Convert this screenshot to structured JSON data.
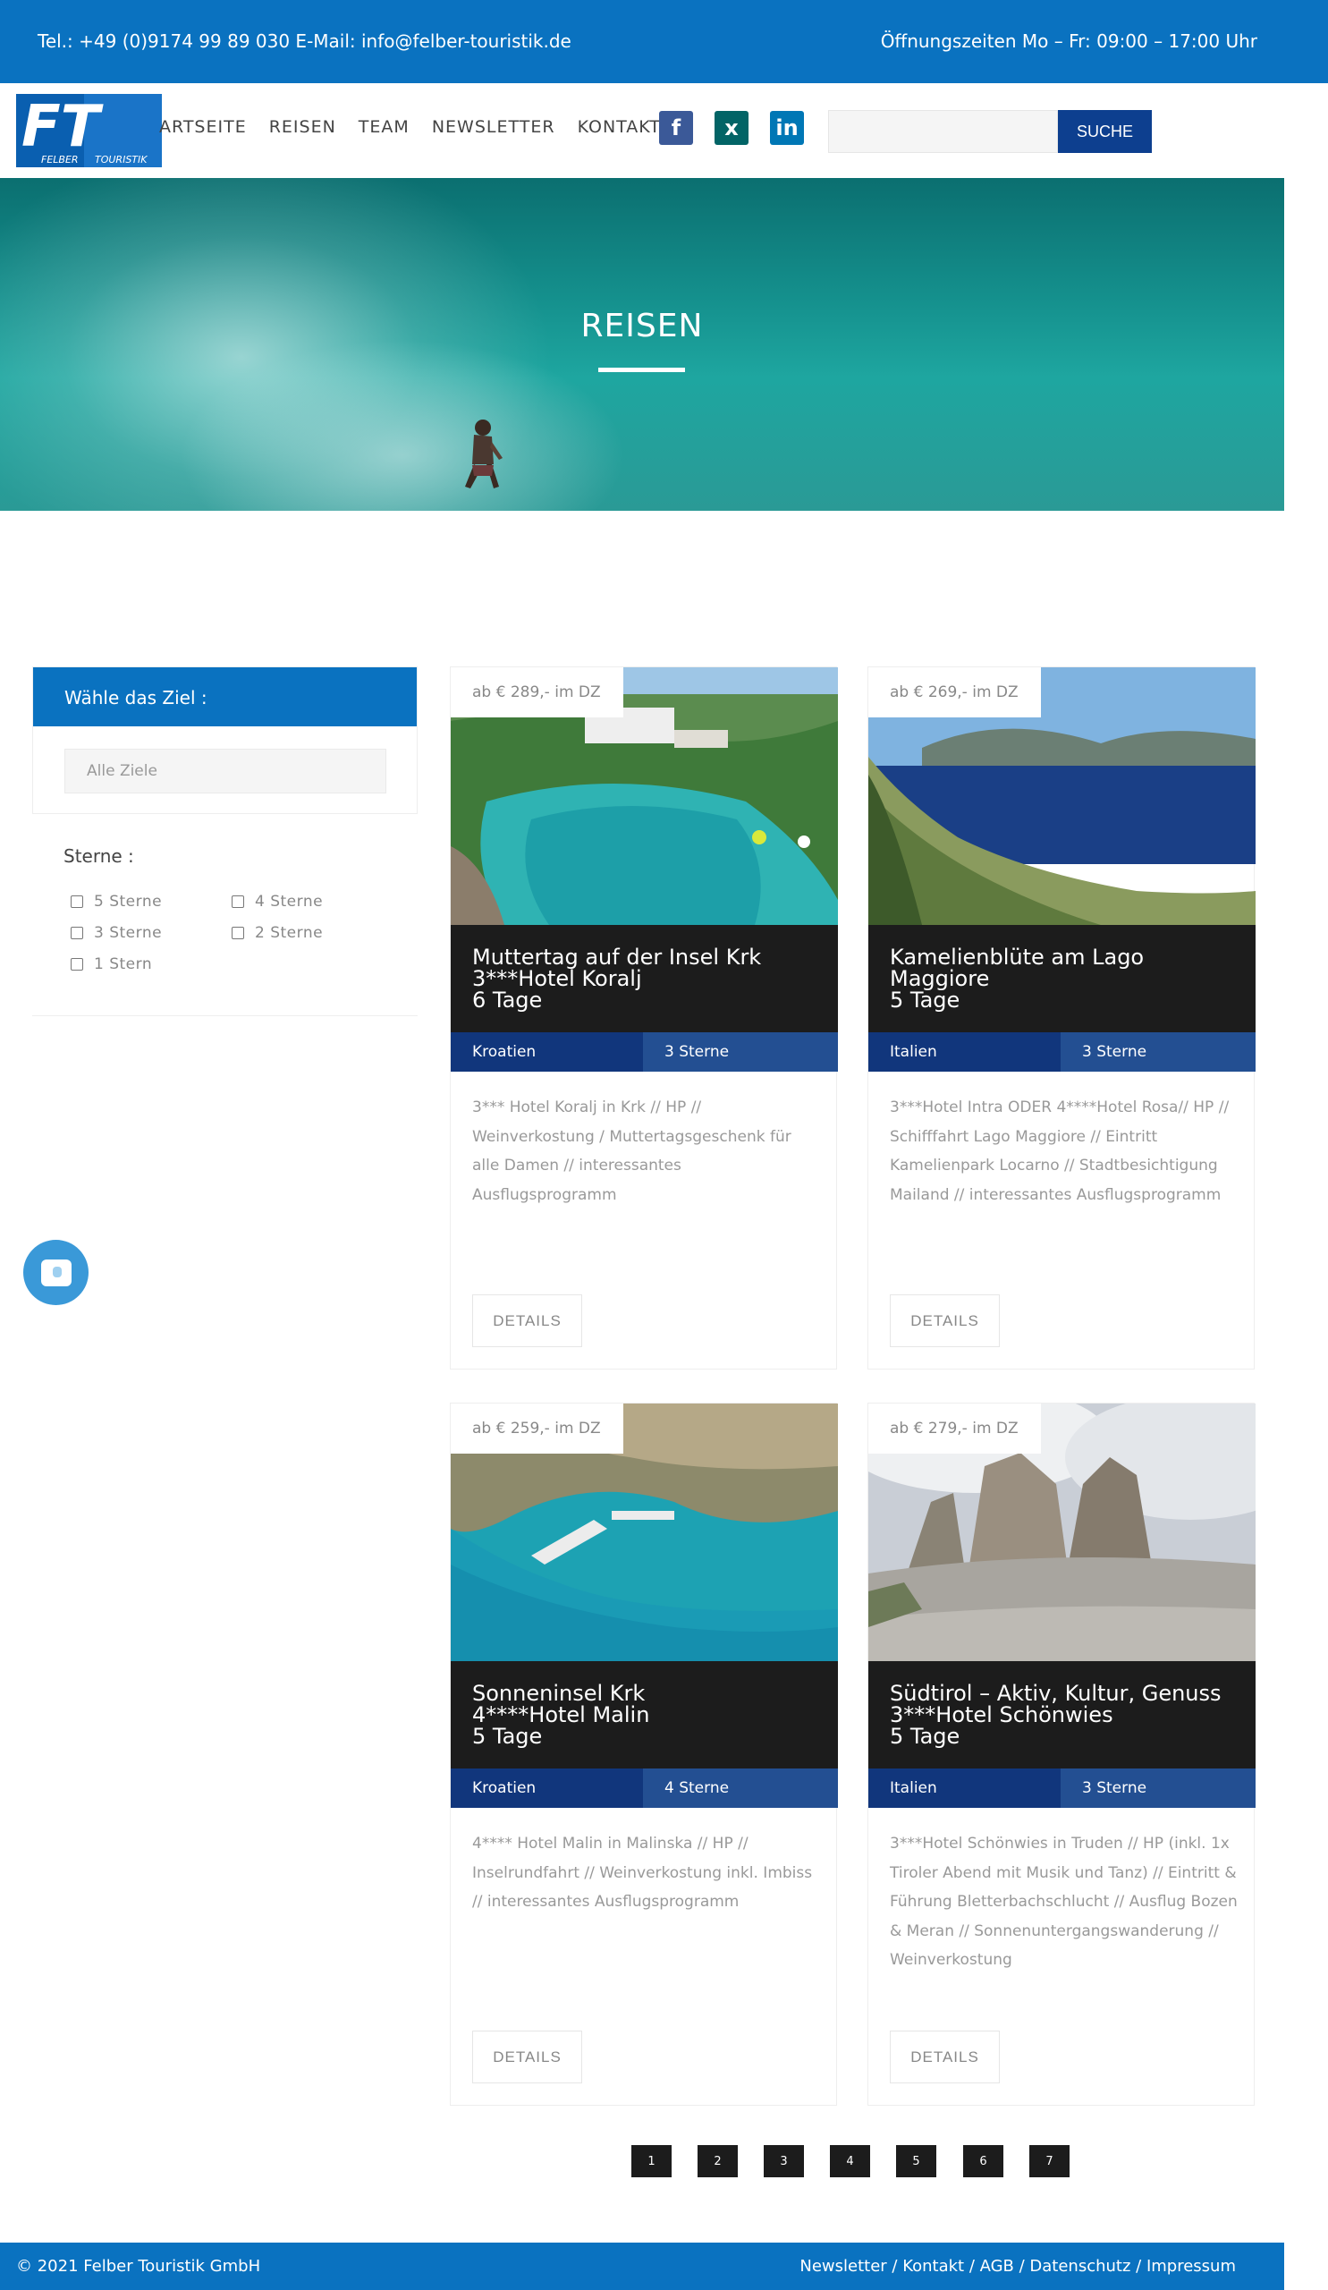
{
  "topbar": {
    "contact": "Tel.: +49 (0)9174 99 89 030 E-Mail: info@felber-touristik.de",
    "hours": "Öffnungszeiten Mo – Fr: 09:00 – 17:00 Uhr"
  },
  "header": {
    "logo_text_main": "FT",
    "logo_text_sub1": "FELBER",
    "logo_text_sub2": "TOURISTIK",
    "nav": [
      "ARTSEITE",
      "REISEN",
      "TEAM",
      "NEWSLETTER",
      "KONTAKT"
    ],
    "social": {
      "fb": "f",
      "xing": "x",
      "li": "in"
    },
    "search_value": "",
    "search_button": "SUCHE"
  },
  "hero": {
    "title": "REISEN"
  },
  "sidebar": {
    "filter_title": "Wähle das Ziel :",
    "filter_value": "Alle Ziele",
    "stars_label": "Sterne :",
    "star_options": [
      "5 Sterne",
      "4 Sterne",
      "3 Sterne",
      "2 Sterne",
      "1 Stern"
    ]
  },
  "cards": [
    {
      "price": "ab € 289,- im DZ",
      "title": [
        "Muttertag auf der Insel Krk",
        "3***Hotel Koralj",
        "6 Tage"
      ],
      "country": "Kroatien",
      "stars": "3 Sterne",
      "desc": "3*** Hotel Koralj in Krk // HP // Weinverkostung / Muttertagsgeschenk für alle Damen // interessantes Ausflugsprogramm",
      "details": "DETAILS"
    },
    {
      "price": "ab € 269,- im DZ",
      "title": [
        "Kamelienblüte am Lago",
        "Maggiore",
        "5 Tage"
      ],
      "country": "Italien",
      "stars": "3 Sterne",
      "desc": "3***Hotel Intra ODER 4****Hotel Rosa// HP // Schifffahrt Lago Maggiore // Eintritt Kamelienpark Locarno // Stadtbesichtigung Mailand // interessantes Ausflugsprogramm",
      "details": "DETAILS"
    },
    {
      "price": "ab € 259,- im DZ",
      "title": [
        "Sonneninsel Krk",
        "4****Hotel Malin",
        "5 Tage"
      ],
      "country": "Kroatien",
      "stars": "4 Sterne",
      "desc": "4**** Hotel Malin in Malinska // HP // Inselrundfahrt // Weinverkostung inkl. Imbiss // interessantes Ausflugsprogramm",
      "details": "DETAILS"
    },
    {
      "price": "ab € 279,- im DZ",
      "title": [
        "Südtirol – Aktiv, Kultur, Genuss",
        "3***Hotel Schönwies",
        "5 Tage"
      ],
      "country": "Italien",
      "stars": "3 Sterne",
      "desc": "3***Hotel Schönwies in Truden // HP (inkl. 1x Tiroler Abend mit Musik und Tanz) // Eintritt & Führung Bletterbachschlucht // Ausflug Bozen & Meran // Sonnenuntergangswanderung // Weinverkostung",
      "details": "DETAILS"
    }
  ],
  "pagination": [
    "1",
    "2",
    "3",
    "4",
    "5",
    "6",
    "7"
  ],
  "footer": {
    "copyright": "© 2021 Felber Touristik GmbH",
    "links": "Newsletter / Kontakt / AGB / Datenschutz / Impressum"
  }
}
